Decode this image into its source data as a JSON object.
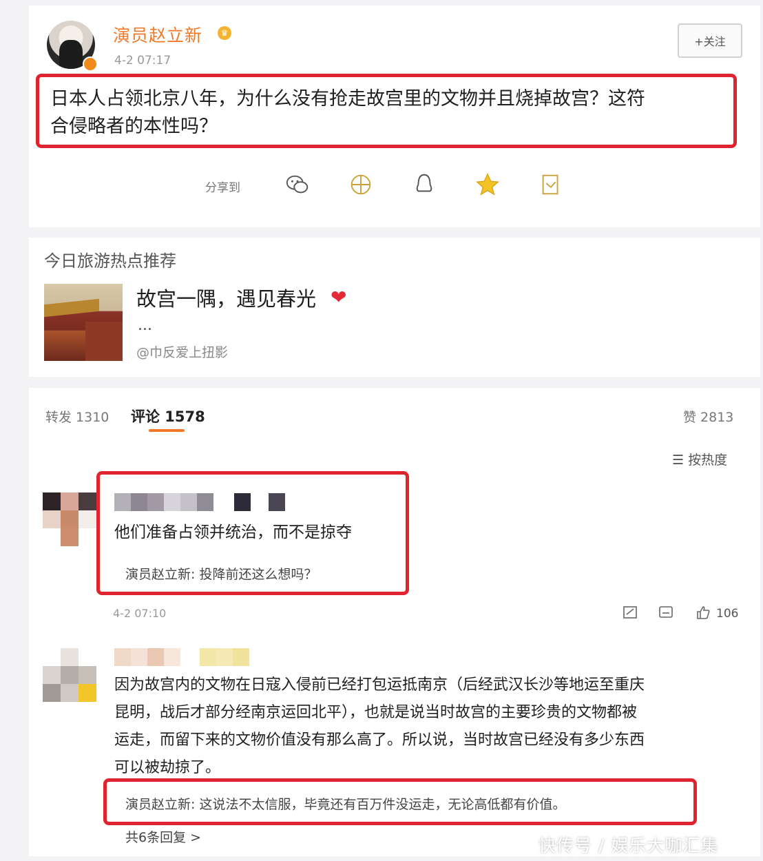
{
  "post": {
    "author": "演员赵立新",
    "time": "4-2 07:17",
    "follow_label": "+关注",
    "text_line1": "日本人占领北京八年，为什么没有抢走故宫里的文物并且烧掉故宫？这符",
    "text_line2": "合侵略者的本性吗？",
    "share_label": "分享到",
    "share_icons": [
      "wechat-icon",
      "moments-icon",
      "qq-icon",
      "qzone-icon",
      "link-icon"
    ]
  },
  "recommendation": {
    "section_title": "今日旅游热点推荐",
    "headline": "故宫一隅，遇见春光",
    "ellipsis": "...",
    "source": "@巾反爱上扭影"
  },
  "comments_section": {
    "repost_tab": "转发 1310",
    "comment_tab": "评论 1578",
    "likes_total": "赞 2813",
    "sort_label": "按热度",
    "comments": [
      {
        "text": "他们准备占领并统治，而不是掠夺",
        "reply": "演员赵立新: 投降前还这么想吗？",
        "time": "4-2 07:10",
        "likes": "106"
      },
      {
        "text_lines": [
          "因为故宫内的文物在日寇入侵前已经打包运抵南京（后经武汉长沙等地运至重庆",
          "昆明，战后才部分经南京运回北平），也就是说当时故宫的主要珍贵的文物都被",
          "运走，而留下来的文物价值没有那么高了。所以说，当时故宫已经没有多少东西",
          "可以被劫掠了。"
        ],
        "reply": "演员赵立新: 这说法不太信服，毕竟还有百万件没运走，无论高低都有价值。",
        "more_replies": "共6条回复 >"
      }
    ]
  },
  "watermark": "快传号 / 娱乐大咖汇集",
  "colors": {
    "accent_orange": "#ef7a28",
    "highlight_red": "#e0242f",
    "background": "#f3f3f5"
  }
}
